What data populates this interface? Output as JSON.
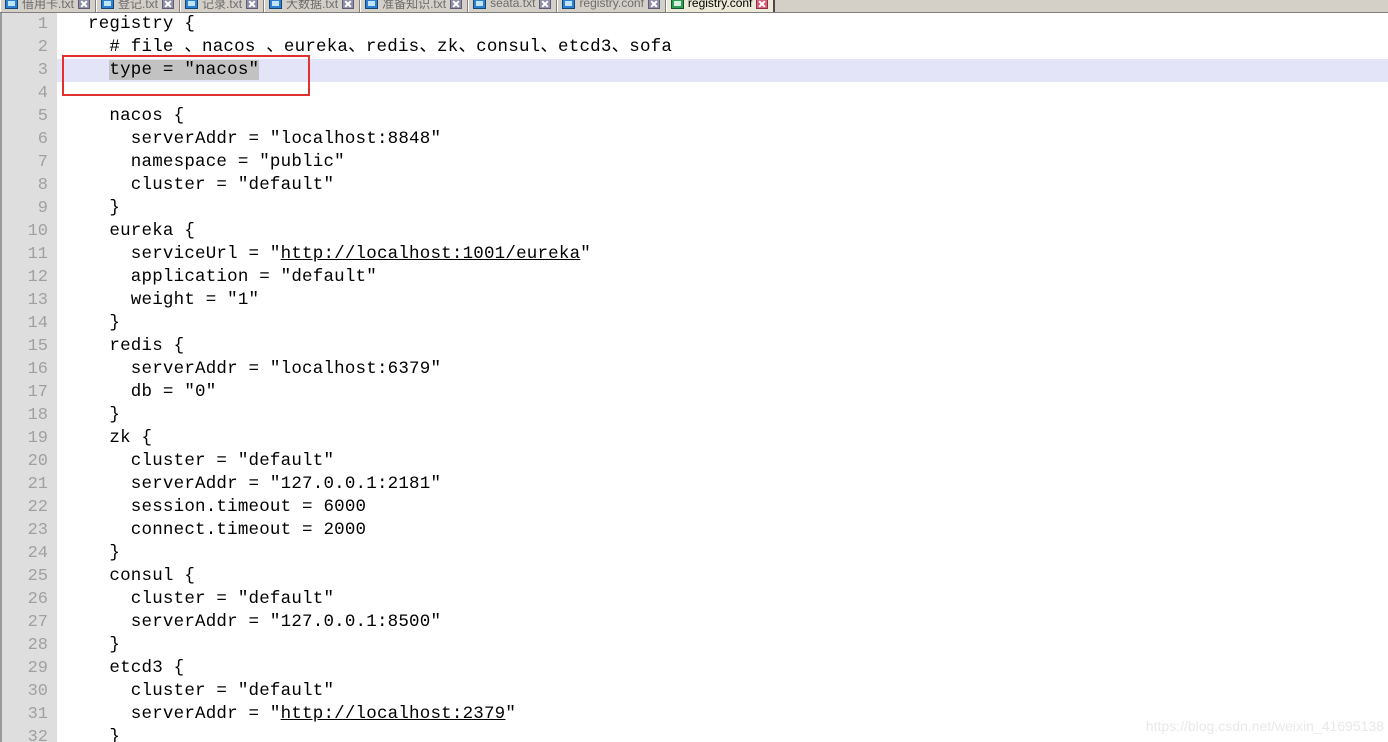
{
  "window": {
    "app_kind": "text-editor",
    "active_document": "registry.conf"
  },
  "tabbar": {
    "tabs": [
      {
        "label": "借用卡.txt",
        "active": false,
        "icon": "document-icon",
        "close_icon": "close-icon"
      },
      {
        "label": "登记.txt",
        "active": false,
        "icon": "document-icon",
        "close_icon": "close-icon"
      },
      {
        "label": "记录.txt",
        "active": false,
        "icon": "document-icon",
        "close_icon": "close-icon"
      },
      {
        "label": "大数据.txt",
        "active": false,
        "icon": "document-icon",
        "close_icon": "close-icon"
      },
      {
        "label": "准备知识.txt",
        "active": false,
        "icon": "document-icon",
        "close_icon": "close-icon"
      },
      {
        "label": "seata.txt",
        "active": false,
        "icon": "document-icon",
        "close_icon": "close-icon"
      },
      {
        "label": "registry.conf",
        "active": false,
        "icon": "document-icon",
        "close_icon": "close-icon"
      },
      {
        "label": "registry.conf",
        "active": true,
        "icon": "document-icon",
        "close_icon": "close-icon"
      }
    ]
  },
  "editor": {
    "filename": "registry.conf",
    "language": "hocon",
    "current_line": 3,
    "selection_text": "type = \"nacos\"",
    "colors": {
      "gutter_bg": "#dedede",
      "gutter_text": "#a0a0a0",
      "editor_bg": "#ffffff",
      "code_text": "#000000",
      "current_line_highlight": "#e4e4f8",
      "selection_bg": "#c2c2c2",
      "annotation_border": "#e03030",
      "watermark_text": "#e9e9e9"
    },
    "lines": [
      {
        "n": 1,
        "text": "registry {"
      },
      {
        "n": 2,
        "text": "  # file 、nacos 、eureka、redis、zk、consul、etcd3、sofa"
      },
      {
        "n": 3,
        "text": "  type = \"nacos\"",
        "selected": true,
        "highlighted": true
      },
      {
        "n": 4,
        "text": ""
      },
      {
        "n": 5,
        "text": "  nacos {"
      },
      {
        "n": 6,
        "text": "    serverAddr = \"localhost:8848\""
      },
      {
        "n": 7,
        "text": "    namespace = \"public\""
      },
      {
        "n": 8,
        "text": "    cluster = \"default\""
      },
      {
        "n": 9,
        "text": "  }"
      },
      {
        "n": 10,
        "text": "  eureka {"
      },
      {
        "n": 11,
        "text": "    serviceUrl = \"http://localhost:1001/eureka\"",
        "url": "http://localhost:1001/eureka"
      },
      {
        "n": 12,
        "text": "    application = \"default\""
      },
      {
        "n": 13,
        "text": "    weight = \"1\""
      },
      {
        "n": 14,
        "text": "  }"
      },
      {
        "n": 15,
        "text": "  redis {"
      },
      {
        "n": 16,
        "text": "    serverAddr = \"localhost:6379\""
      },
      {
        "n": 17,
        "text": "    db = \"0\""
      },
      {
        "n": 18,
        "text": "  }"
      },
      {
        "n": 19,
        "text": "  zk {"
      },
      {
        "n": 20,
        "text": "    cluster = \"default\""
      },
      {
        "n": 21,
        "text": "    serverAddr = \"127.0.0.1:2181\""
      },
      {
        "n": 22,
        "text": "    session.timeout = 6000"
      },
      {
        "n": 23,
        "text": "    connect.timeout = 2000"
      },
      {
        "n": 24,
        "text": "  }"
      },
      {
        "n": 25,
        "text": "  consul {"
      },
      {
        "n": 26,
        "text": "    cluster = \"default\""
      },
      {
        "n": 27,
        "text": "    serverAddr = \"127.0.0.1:8500\""
      },
      {
        "n": 28,
        "text": "  }"
      },
      {
        "n": 29,
        "text": "  etcd3 {"
      },
      {
        "n": 30,
        "text": "    cluster = \"default\""
      },
      {
        "n": 31,
        "text": "    serverAddr = \"http://localhost:2379\"",
        "url": "http://localhost:2379"
      },
      {
        "n": 32,
        "text": "  }"
      }
    ]
  },
  "annotation": {
    "kind": "red-rectangle-highlight",
    "targets_line": 3,
    "targets_text": "type = \"nacos\""
  },
  "watermark": {
    "text": "https://blog.csdn.net/weixin_41695138"
  }
}
